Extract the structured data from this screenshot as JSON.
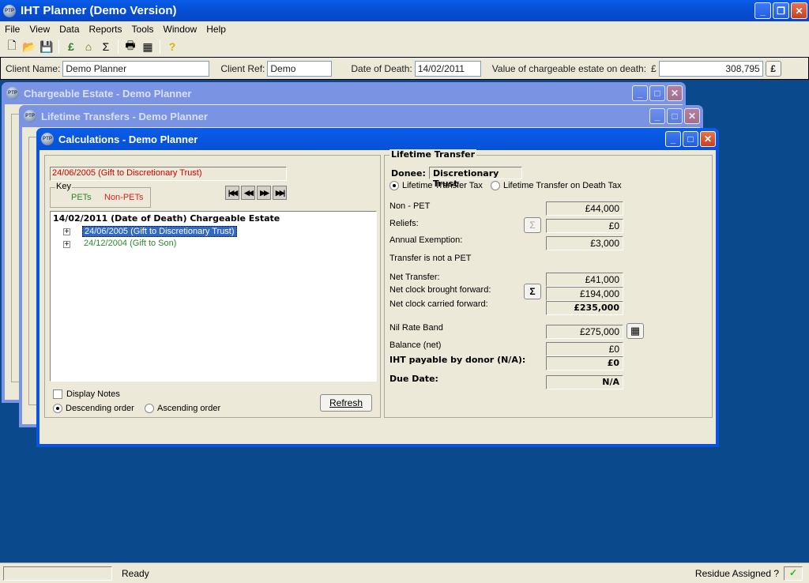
{
  "app": {
    "title": "IHT Planner (Demo Version)",
    "logo": "PTP"
  },
  "menu": [
    "File",
    "View",
    "Data",
    "Reports",
    "Tools",
    "Window",
    "Help"
  ],
  "toolbar_icons": [
    "new-icon",
    "open-icon",
    "save-icon",
    "pound-transfer-icon",
    "estate-icon",
    "sigma-icon",
    "print-icon",
    "clipboard-icon",
    "help-icon"
  ],
  "client": {
    "name_label": "Client Name:",
    "name": "Demo Planner",
    "ref_label": "Client Ref:",
    "ref": "Demo",
    "dod_label": "Date of Death:",
    "dod": "14/02/2011",
    "value_label": "Value of chargeable estate on death:",
    "currency": "£",
    "value": "308,795",
    "pound_btn": "£"
  },
  "windows": {
    "estate": "Chargeable Estate - Demo Planner",
    "transfers": "Lifetime Transfers - Demo Planner",
    "calc": "Calculations - Demo Planner"
  },
  "calc": {
    "selected": "24/06/2005 (Gift to Discretionary Trust)",
    "key_label": "Key",
    "pets": "PETs",
    "nonpets": "Non-PETs",
    "tree": {
      "root": "14/02/2011 (Date of Death) Chargeable Estate",
      "items": [
        "24/06/2005 (Gift to Discretionary Trust)",
        "24/12/2004 (Gift to Son)"
      ]
    },
    "display_notes": "Display Notes",
    "desc": "Descending order",
    "asc": "Ascending order",
    "refresh": "Refresh",
    "lt": {
      "title": "Lifetime Transfer",
      "donee_label": "Donee:",
      "donee": "Discretionary Trust",
      "tax1": "Lifetime Transfer Tax",
      "tax2": "Lifetime Transfer on Death Tax",
      "nonpet_label": "Non - PET",
      "nonpet": "£44,000",
      "reliefs_label": "Reliefs:",
      "reliefs": "£0",
      "annual_label": "Annual Exemption:",
      "annual": "£3,000",
      "notpet": "Transfer is not a PET",
      "net_label": "Net Transfer:",
      "net": "£41,000",
      "bf_label": "Net clock brought forward:",
      "bf": "£194,000",
      "cf_label": "Net clock carried forward:",
      "cf": "£235,000",
      "nrb_label": "Nil Rate Band",
      "nrb": "£275,000",
      "bal_label": "Balance (net)",
      "bal": "£0",
      "iht_label": "IHT payable by donor (N/A):",
      "iht": "£0",
      "due_label": "Due Date:",
      "due": "N/A",
      "sigma": "Σ"
    }
  },
  "status": {
    "text": "Ready",
    "residue": "Residue Assigned ?",
    "check": "✓"
  }
}
